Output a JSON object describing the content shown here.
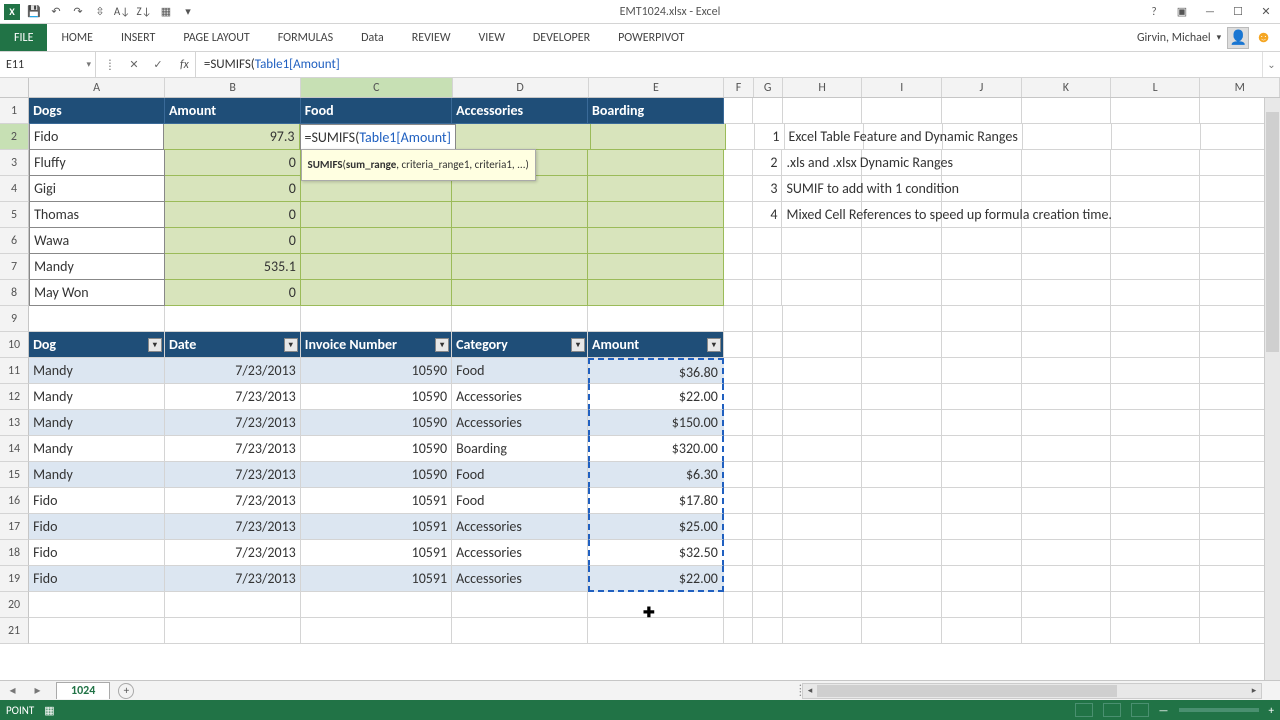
{
  "app": {
    "title": "EMT1024.xlsx - Excel",
    "user": "Girvin, Michael"
  },
  "qat_icons": [
    "save",
    "undo",
    "redo",
    "touch",
    "sort-asc",
    "sort-desc",
    "pivot"
  ],
  "tabs": [
    "HOME",
    "INSERT",
    "PAGE LAYOUT",
    "FORMULAS",
    "Data",
    "REVIEW",
    "VIEW",
    "DEVELOPER",
    "POWERPIVOT"
  ],
  "name_box": "E11",
  "formula": {
    "prefix": "=SUMIFS(",
    "ref": "Table1[Amount]",
    "suffix": ""
  },
  "tooltip": {
    "fn": "SUMIFS",
    "sig": "(sum_range, criteria_range1, criteria1, ...)"
  },
  "columns": [
    "A",
    "B",
    "C",
    "D",
    "E",
    "F",
    "G",
    "H",
    "I",
    "J",
    "K",
    "L",
    "M"
  ],
  "col_widths": [
    "wA",
    "wB",
    "wC",
    "wD",
    "wE",
    "wF",
    "wG",
    "wH",
    "wI",
    "wJ",
    "wK",
    "wL",
    "wM"
  ],
  "summary_header": [
    "Dogs",
    "Amount",
    "Food",
    "Accessories",
    "Boarding"
  ],
  "summary_rows": [
    {
      "dog": "Fido",
      "amount": "97.3",
      "editing": true
    },
    {
      "dog": "Fluffy",
      "amount": "0"
    },
    {
      "dog": "Gigi",
      "amount": "0"
    },
    {
      "dog": "Thomas",
      "amount": "0"
    },
    {
      "dog": "Wawa",
      "amount": "0"
    },
    {
      "dog": "Mandy",
      "amount": "535.1"
    },
    {
      "dog": "May Won",
      "amount": "0"
    }
  ],
  "notes": [
    "Excel Table Feature and Dynamic Ranges",
    ".xls and .xlsx Dynamic Ranges",
    "SUMIF to add with 1 condition",
    "Mixed Cell References to speed up formula creation time."
  ],
  "table_header": [
    "Dog",
    "Date",
    "Invoice Number",
    "Category",
    "Amount"
  ],
  "table_rows": [
    {
      "dog": "Mandy",
      "date": "7/23/2013",
      "inv": "10590",
      "cat": "Food",
      "amt": "$36.80"
    },
    {
      "dog": "Mandy",
      "date": "7/23/2013",
      "inv": "10590",
      "cat": "Accessories",
      "amt": "$22.00"
    },
    {
      "dog": "Mandy",
      "date": "7/23/2013",
      "inv": "10590",
      "cat": "Accessories",
      "amt": "$150.00"
    },
    {
      "dog": "Mandy",
      "date": "7/23/2013",
      "inv": "10590",
      "cat": "Boarding",
      "amt": "$320.00"
    },
    {
      "dog": "Mandy",
      "date": "7/23/2013",
      "inv": "10590",
      "cat": "Food",
      "amt": "$6.30"
    },
    {
      "dog": "Fido",
      "date": "7/23/2013",
      "inv": "10591",
      "cat": "Food",
      "amt": "$17.80"
    },
    {
      "dog": "Fido",
      "date": "7/23/2013",
      "inv": "10591",
      "cat": "Accessories",
      "amt": "$25.00"
    },
    {
      "dog": "Fido",
      "date": "7/23/2013",
      "inv": "10591",
      "cat": "Accessories",
      "amt": "$32.50"
    },
    {
      "dog": "Fido",
      "date": "7/23/2013",
      "inv": "10591",
      "cat": "Accessories",
      "amt": "$22.00"
    }
  ],
  "sheet_tab": "1024",
  "status": "POINT",
  "file_label": "FILE"
}
